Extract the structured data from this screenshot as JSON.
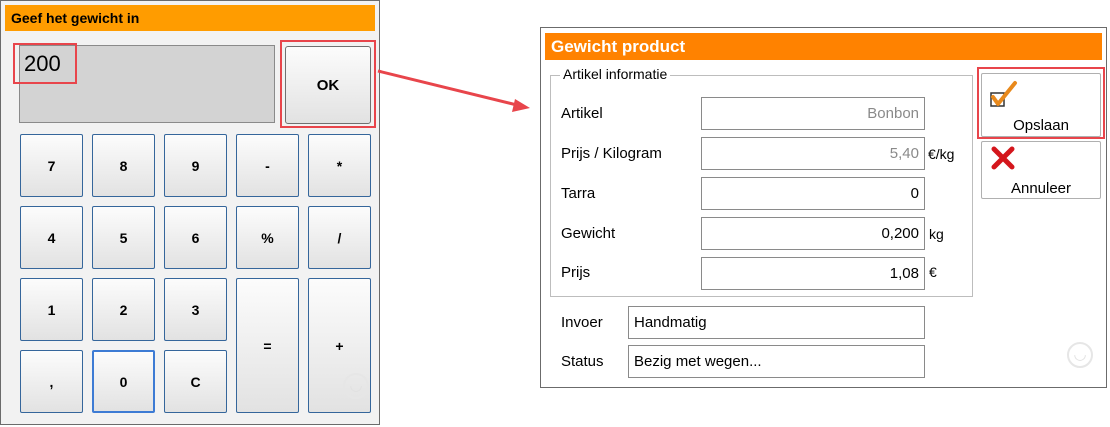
{
  "keypad": {
    "title": "Geef het gewicht in",
    "display_value": "200",
    "ok_label": "OK",
    "keys": {
      "k7": "7",
      "k8": "8",
      "k9": "9",
      "minus": "-",
      "multiply": "*",
      "k4": "4",
      "k5": "5",
      "k6": "6",
      "percent": "%",
      "divide": "/",
      "k1": "1",
      "k2": "2",
      "k3": "3",
      "equals": "=",
      "plus": "+",
      "comma": ",",
      "k0": "0",
      "clear": "C"
    }
  },
  "product": {
    "title": "Gewicht product",
    "group_label": "Artikel informatie",
    "fields": {
      "artikel": {
        "label": "Artikel",
        "value": "Bonbon"
      },
      "prijs_kg": {
        "label": "Prijs / Kilogram",
        "value": "5,40",
        "unit": "€/kg"
      },
      "tarra": {
        "label": "Tarra",
        "value": "0"
      },
      "gewicht": {
        "label": "Gewicht",
        "value": "0,200",
        "unit": "kg"
      },
      "prijs": {
        "label": "Prijs",
        "value": "1,08",
        "unit": "€"
      },
      "invoer": {
        "label": "Invoer",
        "value": "Handmatig"
      },
      "status": {
        "label": "Status",
        "value": "Bezig met wegen..."
      }
    },
    "save_label": "Opslaan",
    "cancel_label": "Annuleer"
  },
  "colors": {
    "keypad_title_bg": "#ff9c00",
    "product_title_bg": "#ff8200",
    "highlight": "#e8454b",
    "button_border": "#35669b",
    "save_check": "#e8891c",
    "cancel_x": "#d4161c"
  },
  "icons": [
    "checkmark-icon",
    "close-x-icon",
    "watermark-icon",
    "arrow-connector"
  ]
}
